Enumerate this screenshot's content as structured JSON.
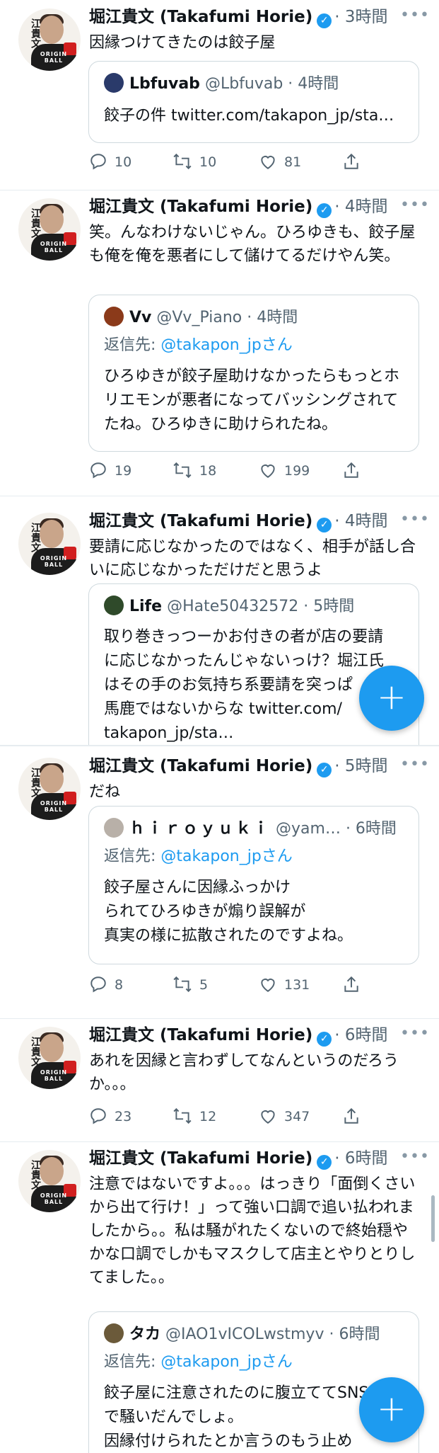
{
  "author": {
    "name": "堀江貴文 (Takafumi Horie)",
    "verified_icon": "check-icon",
    "avatar_title": "江貴文",
    "avatar_sub": "ORIGIN BALL"
  },
  "tweets": [
    {
      "time": "· 3時間",
      "text": "因縁つけてきたのは餃子屋",
      "quote": {
        "name": "Lbfuvab",
        "handle": "@Lbfuvab · 4時間",
        "reply_prefix": "",
        "reply_link": "",
        "text": "餃子の件 twitter.com/takapon_jp/sta…"
      },
      "replies": "10",
      "retweets": "10",
      "likes": "81"
    },
    {
      "time": "· 4時間",
      "text": "笑。んなわけないじゃん。ひろゆきも、餃子屋も俺を俺を悪者にして儲けてるだけやん笑。",
      "quote": {
        "name": "Vv",
        "handle": "@Vv_Piano · 4時間",
        "reply_prefix": "返信先: ",
        "reply_link": "@takapon_jpさん",
        "text": "ひろゆきが餃子屋助けなかったらもっとホリエモンが悪者になってバッシングされてたね。ひろゆきに助けられたね。"
      },
      "replies": "19",
      "retweets": "18",
      "likes": "199"
    },
    {
      "time": "· 4時間",
      "text": "要請に応じなかったのではなく、相手が話し合いに応じなかっただけだと思うよ",
      "quote": {
        "name": "Life",
        "handle": "@Hate50432572 · 5時間",
        "reply_prefix": "",
        "reply_link": "",
        "text": "取り巻きっつーかお付きの者が店の要請に応じなかったんじゃないっけ？堀江氏はその手のお気持ち系要請を突っぱ\n馬鹿ではないからな twitter.com/\ntakapon_jp/sta…"
      }
    },
    {
      "time": "· 5時間",
      "text": "だね",
      "quote": {
        "name": "ｈｉｒｏｙｕｋｉ",
        "handle": "@yam… · 6時間",
        "reply_prefix": "返信先: ",
        "reply_link": "@takapon_jpさん",
        "text": "餃子屋さんに因縁ふっかけ\nられてひろゆきが煽り誤解が\n真実の様に拡散されたのですよね。"
      },
      "replies": "8",
      "retweets": "5",
      "likes": "131"
    },
    {
      "time": "· 6時間",
      "text": "あれを因縁と言わずしてなんというのだろうか。。。",
      "replies": "23",
      "retweets": "12",
      "likes": "347"
    },
    {
      "time": "· 6時間",
      "text": "注意ではないですよ。。。はっきり「面倒くさいから出て行け！」って強い口調で追い払われましたから。。私は騒がれたくないので終始穏やかな口調でしかもマスクして店主とやりとりしてました。。",
      "quote": {
        "name": "タカ",
        "handle": "@IAO1vICOLwstmyv · 6時間",
        "reply_prefix": "返信先: ",
        "reply_link": "@takapon_jpさん",
        "text": "餃子屋に注意されたのに腹立ててSNS\nで騒いだんでしょ。\n因縁付けられたとか言うのもう止め"
      }
    }
  ],
  "fab_label": "+",
  "colors": {
    "accent": "#1d9bf0",
    "text": "#0f1419",
    "muted": "#536471"
  }
}
